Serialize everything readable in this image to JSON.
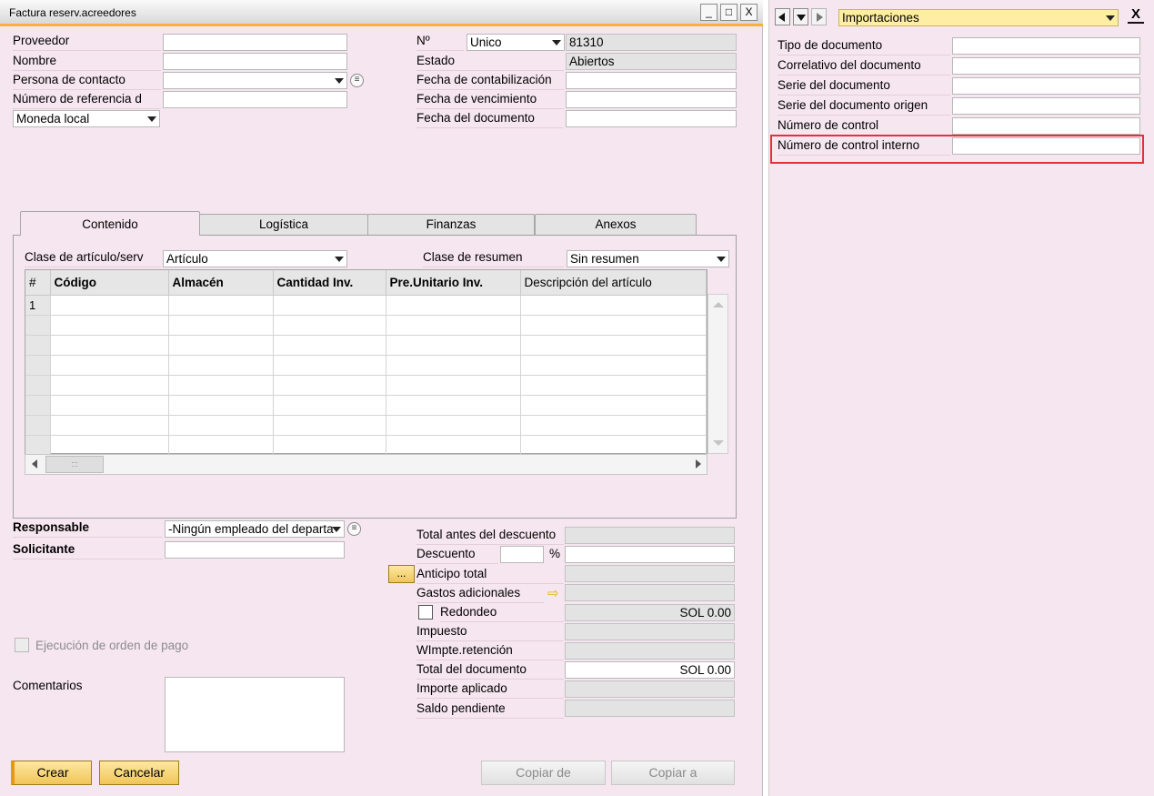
{
  "window": {
    "title": "Factura reserv.acreedores",
    "minimize": "_",
    "maximize": "□",
    "close": "X"
  },
  "header_left": {
    "proveedor_label": "Proveedor",
    "nombre_label": "Nombre",
    "persona_contacto_label": "Persona de contacto",
    "numero_referencia_label": "Número de referencia d",
    "moneda_select": "Moneda local"
  },
  "header_right": {
    "no_label": "Nº",
    "series_select": "Unico",
    "doc_number": "81310",
    "estado_label": "Estado",
    "estado_value": "Abiertos",
    "fecha_contab_label": "Fecha de contabilización",
    "fecha_venc_label": "Fecha de vencimiento",
    "fecha_doc_label": "Fecha del documento"
  },
  "tabs": [
    "Contenido",
    "Logística",
    "Finanzas",
    "Anexos"
  ],
  "content": {
    "clase_articulo_label": "Clase de artículo/serv",
    "clase_articulo_value": "Artículo",
    "clase_resumen_label": "Clase de resumen",
    "clase_resumen_value": "Sin resumen",
    "grid_headers": [
      "#",
      "Código",
      "Almacén",
      "Cantidad Inv.",
      "Pre.Unitario Inv.",
      "Descripción del artículo"
    ],
    "first_row_number": "1"
  },
  "footer_left": {
    "responsable_label": "Responsable",
    "responsable_value": "-Ningún empleado del departa",
    "solicitante_label": "Solicitante",
    "ejecucion_label": "Ejecución de orden de pago",
    "comentarios_label": "Comentarios"
  },
  "totals": {
    "total_antes_label": "Total antes del descuento",
    "descuento_label": "Descuento",
    "percent_sign": "%",
    "anticipo_button": "...",
    "anticipo_label": "Anticipo total",
    "gastos_label": "Gastos adicionales",
    "redondeo_label": "Redondeo",
    "redondeo_value": "SOL 0.00",
    "impuesto_label": "Impuesto",
    "wimpte_label": "WImpte.retención",
    "total_documento_label": "Total del documento",
    "total_documento_value": "SOL 0.00",
    "importe_aplicado_label": "Importe aplicado",
    "saldo_pendiente_label": "Saldo pendiente"
  },
  "buttons": {
    "crear": "Crear",
    "cancelar": "Cancelar",
    "copiar_de": "Copiar de",
    "copiar_a": "Copiar a"
  },
  "side_panel": {
    "category_select": "Importaciones",
    "close_label": "X",
    "fields": [
      "Tipo de documento",
      "Correlativo del documento",
      "Serie del documento",
      "Serie del documento origen",
      "Número de control",
      "Número de control interno"
    ],
    "highlight_color": "#e0333a"
  }
}
